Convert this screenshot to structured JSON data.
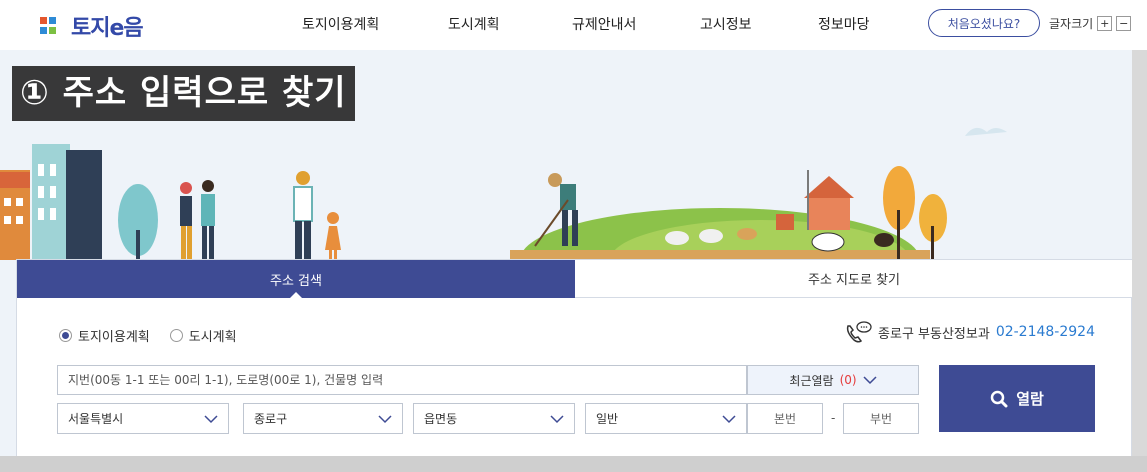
{
  "header": {
    "logo_text": "토지e음",
    "nav": [
      "토지이용계획",
      "도시계획",
      "규제안내서",
      "고시정보",
      "정보마당"
    ],
    "first_visit": "처음오셨나요?",
    "font_size_label": "글자크기",
    "font_plus": "+",
    "font_minus": "−"
  },
  "overlay": {
    "step_title": "① 주소 입력으로 찾기"
  },
  "panel": {
    "tabs": [
      "주소 검색",
      "주소 지도로 찾기"
    ],
    "radios": [
      {
        "label": "토지이용계획",
        "checked": true
      },
      {
        "label": "도시계획",
        "checked": false
      }
    ],
    "contact": {
      "office": "종로구 부동산정보과",
      "phone": "02-2148-2924"
    },
    "search": {
      "placeholder": "지번(00동 1-1 또는 00리 1-1), 도로명(00로 1), 건물명 입력"
    },
    "recent": {
      "label": "최근열람",
      "count": "(0)"
    },
    "selects": [
      "서울특별시",
      "종로구",
      "읍면동",
      "일반"
    ],
    "main_number": "본번",
    "sub_number": "부번",
    "dash": "-",
    "view_button": "열람"
  },
  "colors": {
    "primary": "#3e4b94",
    "link": "#2b7bd0",
    "alert": "#e53b3b"
  }
}
